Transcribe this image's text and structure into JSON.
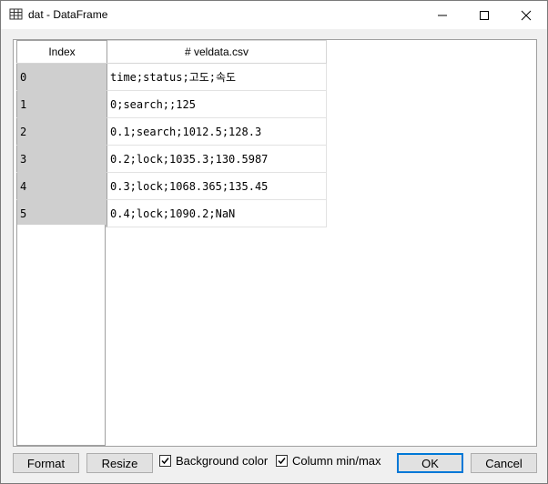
{
  "window": {
    "title": "dat - DataFrame",
    "icon": "table-icon"
  },
  "table": {
    "index_header": "Index",
    "column_header": "# veldata.csv",
    "rows": [
      {
        "index": "0",
        "value": "time;status;고도;속도"
      },
      {
        "index": "1",
        "value": "0;search;;125"
      },
      {
        "index": "2",
        "value": "0.1;search;1012.5;128.3"
      },
      {
        "index": "3",
        "value": "0.2;lock;1035.3;130.5987"
      },
      {
        "index": "4",
        "value": "0.3;lock;1068.365;135.45"
      },
      {
        "index": "5",
        "value": "0.4;lock;1090.2;NaN"
      }
    ]
  },
  "footer": {
    "format_label": "Format",
    "resize_label": "Resize",
    "background_color_label": "Background color",
    "background_color_checked": true,
    "column_minmax_label": "Column min/max",
    "column_minmax_checked": true,
    "ok_label": "OK",
    "cancel_label": "Cancel"
  },
  "colors": {
    "index_bg": "#cfcfcf",
    "ok_border": "#0078d7"
  }
}
